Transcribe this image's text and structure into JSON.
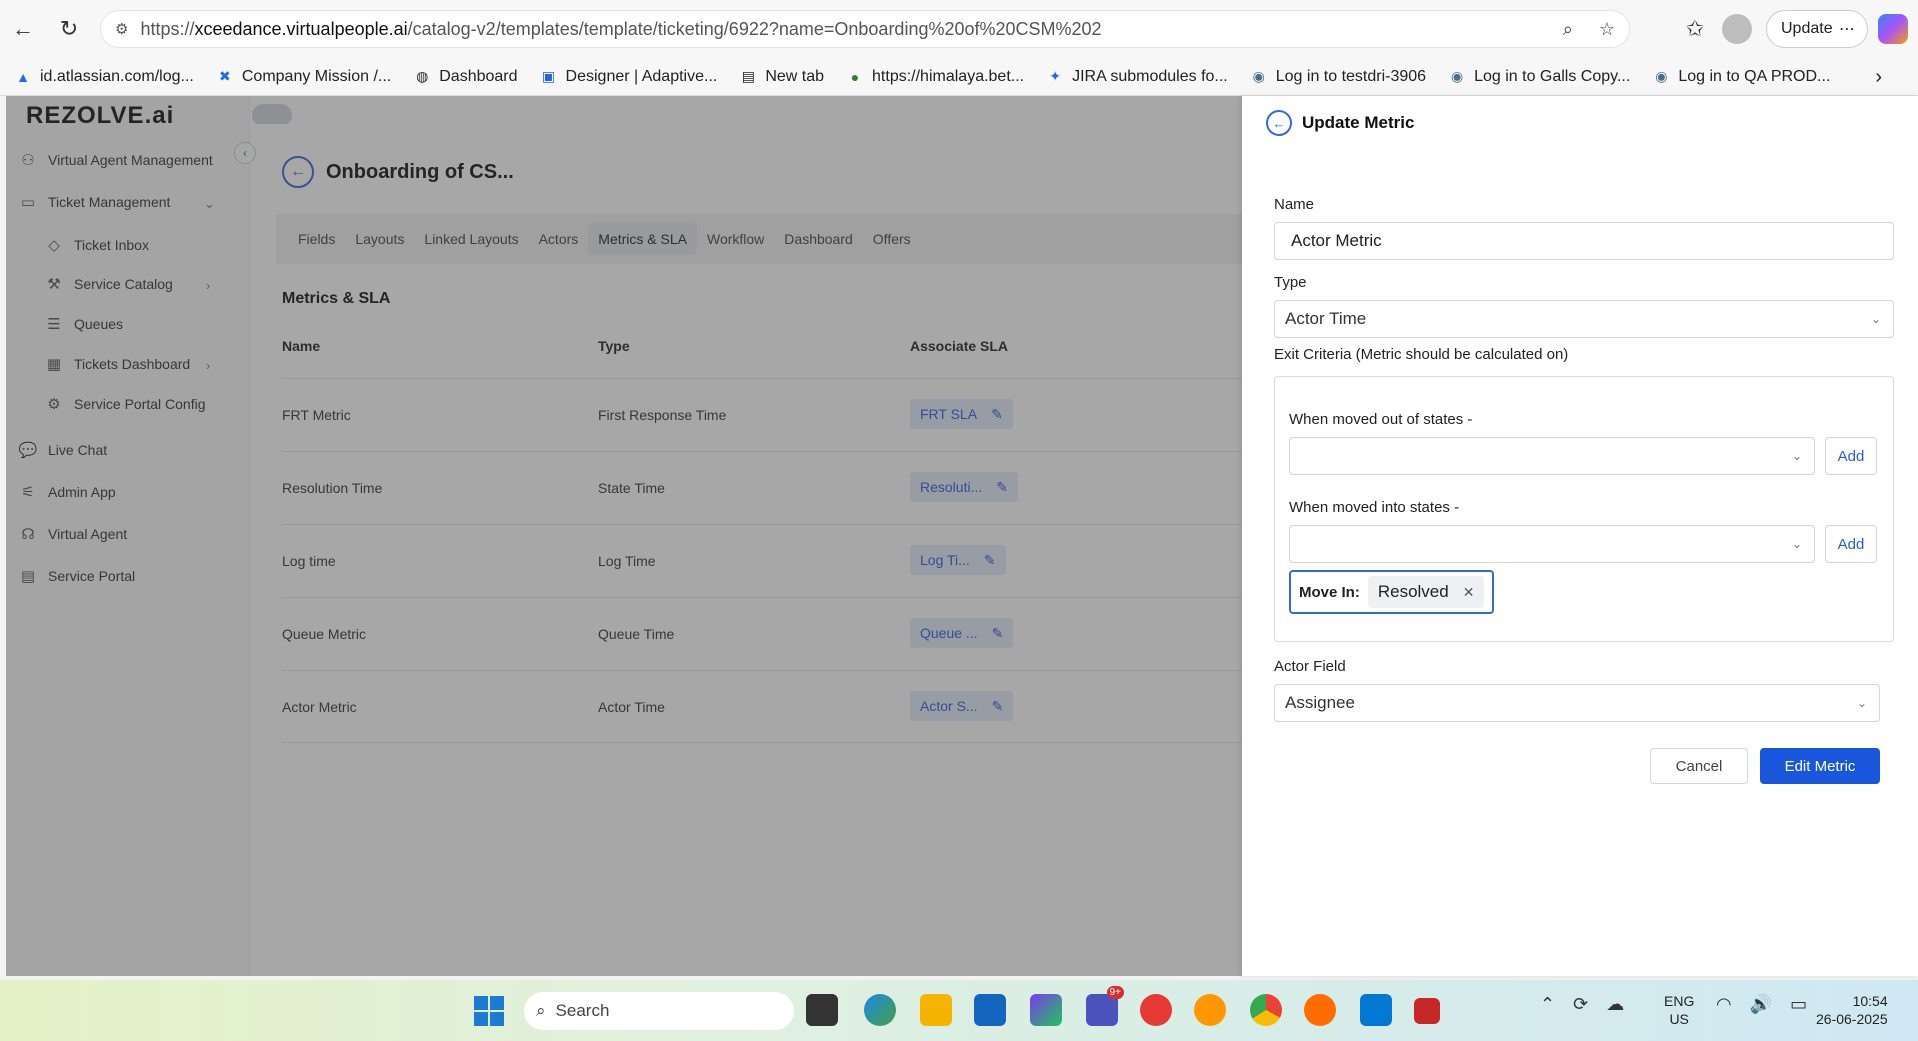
{
  "browser": {
    "url_prefix": "https://",
    "url_domain": "xceedance.virtualpeople.ai",
    "url_path": "/catalog-v2/templates/template/ticketing/6922?name=Onboarding%20of%20CSM%202",
    "update_label": "Update",
    "bookmarks": [
      {
        "label": "id.atlassian.com/log...",
        "icon": "atlassian-icon"
      },
      {
        "label": "Company Mission /...",
        "icon": "bookmark-x-icon"
      },
      {
        "label": "Dashboard",
        "icon": "globe-icon"
      },
      {
        "label": "Designer | Adaptive...",
        "icon": "designer-icon"
      },
      {
        "label": "New tab",
        "icon": "newtab-icon"
      },
      {
        "label": "https://himalaya.bet...",
        "icon": "himalaya-icon"
      },
      {
        "label": "JIRA submodules fo...",
        "icon": "jira-icon"
      },
      {
        "label": "Log in to testdri-3906",
        "icon": "login-icon"
      },
      {
        "label": "Log in to Galls Copy...",
        "icon": "login-icon"
      },
      {
        "label": "Log in to QA PROD...",
        "icon": "login-icon"
      }
    ]
  },
  "app": {
    "logo": "REZOLVE.ai",
    "sidebar": [
      {
        "label": "Virtual Agent Management",
        "icon": "agents-icon"
      },
      {
        "label": "Ticket Management",
        "icon": "ticket-icon"
      },
      {
        "label": "Ticket Inbox",
        "icon": "tag-icon"
      },
      {
        "label": "Service Catalog",
        "icon": "wrench-icon"
      },
      {
        "label": "Queues",
        "icon": "list-icon"
      },
      {
        "label": "Tickets Dashboard",
        "icon": "grid-icon"
      },
      {
        "label": "Service Portal Config",
        "icon": "gear-doc-icon"
      },
      {
        "label": "Live Chat",
        "icon": "chat-icon"
      },
      {
        "label": "Admin App",
        "icon": "sliders-icon"
      },
      {
        "label": "Virtual Agent",
        "icon": "headset-icon"
      },
      {
        "label": "Service Portal",
        "icon": "portal-icon"
      }
    ],
    "page_title": "Onboarding of CS...",
    "tabs": [
      "Fields",
      "Layouts",
      "Linked Layouts",
      "Actors",
      "Metrics & SLA",
      "Workflow",
      "Dashboard",
      "Offers"
    ],
    "section_title": "Metrics & SLA",
    "columns": [
      "Name",
      "Type",
      "Associate SLA"
    ],
    "rows": [
      {
        "name": "FRT Metric",
        "type": "First Response Time",
        "sla": "FRT SLA"
      },
      {
        "name": "Resolution Time",
        "type": "State Time",
        "sla": "Resoluti..."
      },
      {
        "name": "Log time",
        "type": "Log Time",
        "sla": "Log Ti..."
      },
      {
        "name": "Queue Metric",
        "type": "Queue Time",
        "sla": "Queue ..."
      },
      {
        "name": "Actor Metric",
        "type": "Actor Time",
        "sla": "Actor S..."
      }
    ]
  },
  "drawer": {
    "title": "Update Metric",
    "name_label": "Name",
    "name_value": "Actor Metric",
    "type_label": "Type",
    "type_value": "Actor Time",
    "exit_label": "Exit Criteria (Metric should be calculated on)",
    "out_label": "When moved out of states -",
    "into_label": "When moved into states -",
    "add_label": "Add",
    "movein_label": "Move In:",
    "movein_value": "Resolved",
    "actor_label": "Actor Field",
    "actor_value": "Assignee",
    "cancel_label": "Cancel",
    "edit_label": "Edit Metric"
  },
  "taskbar": {
    "search_label": "Search",
    "lang_top": "ENG",
    "lang_bottom": "US",
    "time": "10:54",
    "date": "26-06-2025",
    "teams_badge": "9+"
  }
}
